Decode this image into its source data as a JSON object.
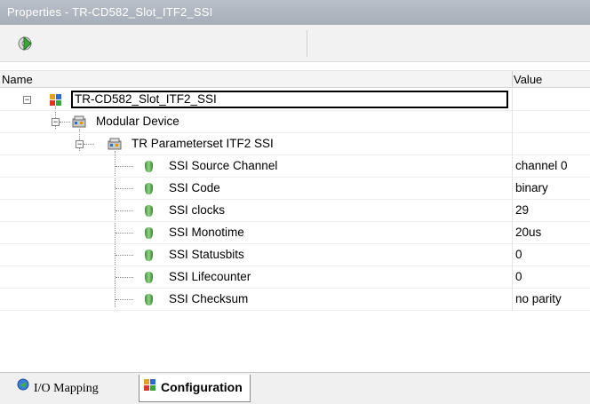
{
  "window": {
    "title": "Properties - TR-CD582_Slot_ITF2_SSI"
  },
  "toolbar": {
    "refresh_icon": "green-arrow-gear-icon"
  },
  "columns": {
    "name": "Name",
    "value": "Value"
  },
  "tree": {
    "root": {
      "label": "TR-CD582_Slot_ITF2_SSI",
      "icon": "device-slot-icon",
      "expanded": true
    },
    "modular": {
      "label": "Modular Device",
      "icon": "module-icon",
      "expanded": true
    },
    "parameterset": {
      "label": "TR Parameterset ITF2 SSI",
      "icon": "module-icon",
      "expanded": true
    },
    "params": [
      {
        "name": "SSI Source Channel",
        "value": "channel 0"
      },
      {
        "name": "SSI Code",
        "value": "binary"
      },
      {
        "name": "SSI clocks",
        "value": "29"
      },
      {
        "name": "SSI Monotime",
        "value": "20us"
      },
      {
        "name": "SSI Statusbits",
        "value": "0"
      },
      {
        "name": "SSI Lifecounter",
        "value": "0"
      },
      {
        "name": "SSI Checksum",
        "value": "no parity"
      }
    ]
  },
  "tabs": [
    {
      "label": "I/O Mapping",
      "icon": "io-mapping-icon",
      "active": false
    },
    {
      "label": "Configuration",
      "icon": "configuration-icon",
      "active": true
    }
  ],
  "colors": {
    "titlebar": "#a9b0bb",
    "param_icon": "#5fb15a"
  }
}
